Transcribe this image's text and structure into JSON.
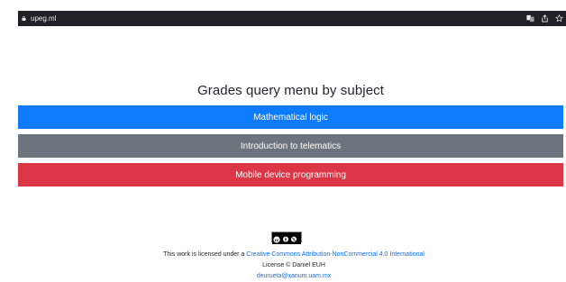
{
  "browser": {
    "url": "upeg.ml",
    "icons": [
      "lock-icon",
      "translate-icon",
      "share-icon",
      "bookmark-star-icon"
    ]
  },
  "page": {
    "title": "Grades query menu by subject",
    "buttons": [
      {
        "label": "Mathematical logic",
        "color": "#0d7bff"
      },
      {
        "label": "Introduction to telematics",
        "color": "#6c757d"
      },
      {
        "label": "Mobile device programming",
        "color": "#dc3545"
      }
    ]
  },
  "footer": {
    "badge_icon": "cc-by-nc-badge-icon",
    "license_prefix": "This work is licensed under a ",
    "license_link": "Creative Commons Attribution-NonCommercial 4.0 International",
    "license_line": "License © Daniel EUH",
    "email": "deurueta@xanum.uam.mx"
  }
}
